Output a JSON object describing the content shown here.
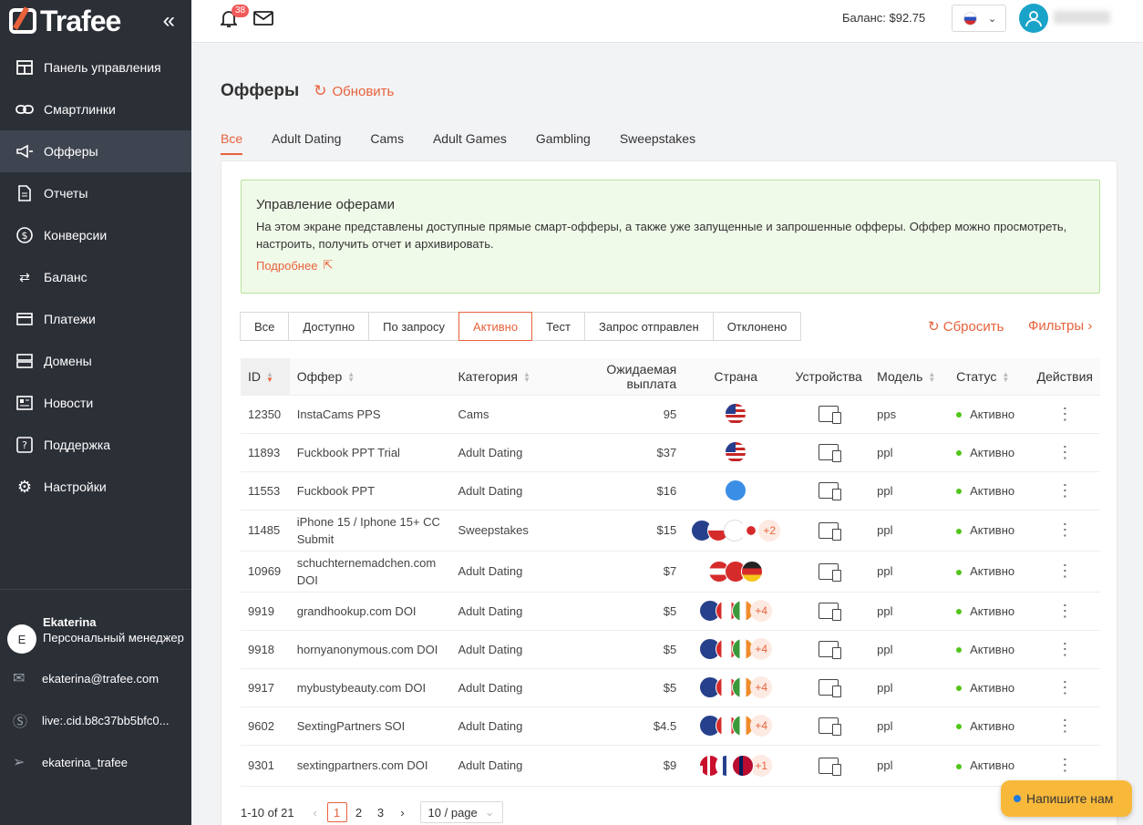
{
  "app": {
    "logo": "Trafee",
    "collapse_icon": "double-chevron-left-icon"
  },
  "sidebar": {
    "items": [
      {
        "label": "Панель управления",
        "icon": "dashboard-icon"
      },
      {
        "label": "Смартлинки",
        "icon": "link-icon"
      },
      {
        "label": "Офферы",
        "icon": "megaphone-icon",
        "active": true
      },
      {
        "label": "Отчеты",
        "icon": "document-icon"
      },
      {
        "label": "Конверсии",
        "icon": "dollar-icon"
      },
      {
        "label": "Баланс",
        "icon": "exchange-icon"
      },
      {
        "label": "Платежи",
        "icon": "card-icon"
      },
      {
        "label": "Домены",
        "icon": "server-icon"
      },
      {
        "label": "Новости",
        "icon": "news-icon"
      },
      {
        "label": "Поддержка",
        "icon": "help-icon"
      },
      {
        "label": "Настройки",
        "icon": "gear-icon"
      }
    ]
  },
  "manager": {
    "initial": "E",
    "name": "Ekaterina",
    "role": "Персональный менеджер",
    "email": "ekaterina@trafee.com",
    "skype": "live:.cid.b8c37bb5bfc0...",
    "telegram": "ekaterina_trafee"
  },
  "topbar": {
    "notifications": "38",
    "balance": "Баланс: $92.75"
  },
  "page": {
    "title": "Офферы",
    "refresh": "Обновить"
  },
  "tabs": [
    "Все",
    "Adult Dating",
    "Cams",
    "Adult Games",
    "Gambling",
    "Sweepstakes"
  ],
  "info": {
    "title": "Управление оферами",
    "text": "На этом экране представлены доступные прямые смарт-офферы, а также уже запущенные и запрошенные офферы. Оффер можно просмотреть, настроить, получить отчет и архивировать.",
    "link": "Подробнее"
  },
  "status_filters": [
    "Все",
    "Доступно",
    "По запросу",
    "Активно",
    "Тест",
    "Запрос отправлен",
    "Отклонено"
  ],
  "reset": "Сбросить",
  "filters": "Фильтры",
  "columns": [
    "ID",
    "Оффер",
    "Категория",
    "Ожидаемая выплата",
    "Страна",
    "Устройства",
    "Модель",
    "Статус",
    "Действия"
  ],
  "rows": [
    {
      "id": "12350",
      "offer": "InstaCams PPS",
      "category": "Cams",
      "payout": "95",
      "flags": [
        "us"
      ],
      "extra": "",
      "model": "pps",
      "status": "Активно"
    },
    {
      "id": "11893",
      "offer": "Fuckbook PPT Trial",
      "category": "Adult Dating",
      "payout": "$37",
      "flags": [
        "us"
      ],
      "extra": "",
      "model": "ppl",
      "status": "Активно"
    },
    {
      "id": "11553",
      "offer": "Fuckbook PPT",
      "category": "Adult Dating",
      "payout": "$16",
      "flags": [
        "world"
      ],
      "extra": "",
      "model": "ppl",
      "status": "Активно"
    },
    {
      "id": "11485",
      "offer": "iPhone 15 / Iphone 15+ CC Submit",
      "category": "Sweepstakes",
      "payout": "$15",
      "flags": [
        "au",
        "cz",
        "kr",
        "jp"
      ],
      "extra": "+2",
      "model": "ppl",
      "status": "Активно"
    },
    {
      "id": "10969",
      "offer": "schuchternemadchen.com DOI",
      "category": "Adult Dating",
      "payout": "$7",
      "flags": [
        "at",
        "ch",
        "de"
      ],
      "extra": "",
      "model": "ppl",
      "status": "Активно"
    },
    {
      "id": "9919",
      "offer": "grandhookup.com DOI",
      "category": "Adult Dating",
      "payout": "$5",
      "flags": [
        "au",
        "ca",
        "ie"
      ],
      "extra": "+4",
      "model": "ppl",
      "status": "Активно"
    },
    {
      "id": "9918",
      "offer": "hornyanonymous.com DOI",
      "category": "Adult Dating",
      "payout": "$5",
      "flags": [
        "au",
        "ca",
        "ie"
      ],
      "extra": "+4",
      "model": "ppl",
      "status": "Активно"
    },
    {
      "id": "9917",
      "offer": "mybustybeauty.com DOI",
      "category": "Adult Dating",
      "payout": "$5",
      "flags": [
        "au",
        "ca",
        "ie"
      ],
      "extra": "+4",
      "model": "ppl",
      "status": "Активно"
    },
    {
      "id": "9602",
      "offer": "SextingPartners SOI",
      "category": "Adult Dating",
      "payout": "$4.5",
      "flags": [
        "au",
        "ca",
        "ie"
      ],
      "extra": "+4",
      "model": "ppl",
      "status": "Активно"
    },
    {
      "id": "9301",
      "offer": "sextingpartners.com DOI",
      "category": "Adult Dating",
      "payout": "$9",
      "flags": [
        "dk",
        "fi",
        "no"
      ],
      "extra": "+1",
      "model": "ppl",
      "status": "Активно"
    }
  ],
  "pager": {
    "summary": "1-10 of 21",
    "pages": [
      "1",
      "2",
      "3"
    ],
    "page_size": "10 / page"
  },
  "chat": "Напишите нам",
  "colors": {
    "accent": "#e8623c",
    "sidebar": "#2b2f36",
    "active_status": "#52c41a"
  }
}
